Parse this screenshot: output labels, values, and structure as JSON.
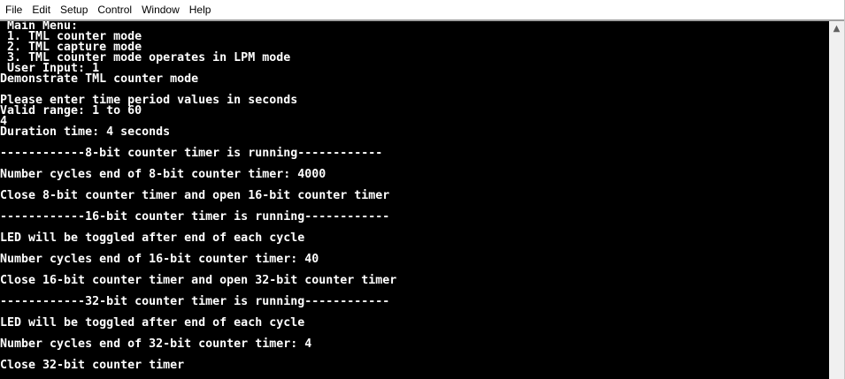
{
  "menu": [
    "File",
    "Edit",
    "Setup",
    "Control",
    "Window",
    "Help"
  ],
  "terminal": {
    "lines": [
      " Main Menu:",
      " 1. TML counter mode",
      " 2. TML capture mode",
      " 3. TML counter mode operates in LPM mode",
      " User Input: 1",
      "Demonstrate TML counter mode",
      "",
      "Please enter time period values in seconds",
      "Valid range: 1 to 60",
      "4",
      "Duration time: 4 seconds",
      "",
      "------------8-bit counter timer is running------------",
      "",
      "Number cycles end of 8-bit counter timer: 4000",
      "",
      "Close 8-bit counter timer and open 16-bit counter timer",
      "",
      "------------16-bit counter timer is running------------",
      "",
      "LED will be toggled after end of each cycle",
      "",
      "Number cycles end of 16-bit counter timer: 40",
      "",
      "Close 16-bit counter timer and open 32-bit counter timer",
      "",
      "------------32-bit counter timer is running------------",
      "",
      "LED will be toggled after end of each cycle",
      "",
      "Number cycles end of 32-bit counter timer: 4",
      "",
      "Close 32-bit counter timer"
    ]
  },
  "scrollbar": {
    "up_arrow": "^"
  }
}
